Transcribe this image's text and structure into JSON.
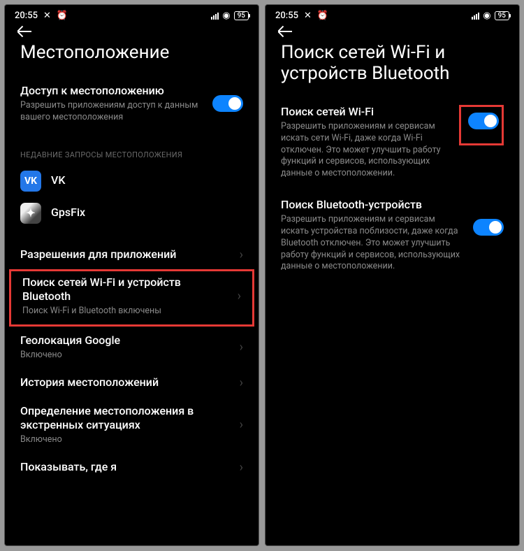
{
  "status": {
    "time": "20:55",
    "battery": "95"
  },
  "left": {
    "title": "Местоположение",
    "access": {
      "title": "Доступ к местоположению",
      "sub": "Разрешить приложениям доступ к данным вашего местоположения"
    },
    "recent_label": "НЕДАВНИЕ ЗАПРОСЫ МЕСТОПОЛОЖЕНИЯ",
    "apps": {
      "vk": "VK",
      "gpsfix": "GpsFix"
    },
    "perm": {
      "title": "Разрешения для приложений"
    },
    "scan": {
      "title": "Поиск сетей Wi-Fi и устройств Bluetooth",
      "sub": "Поиск Wi-Fi и Bluetooth включены"
    },
    "google": {
      "title": "Геолокация Google",
      "sub": "Включено"
    },
    "history": {
      "title": "История местоположений"
    },
    "emergency": {
      "title": "Определение местоположения в экстренных ситуациях",
      "sub": "Включено"
    },
    "show": {
      "title": "Показывать, где я"
    }
  },
  "right": {
    "title": "Поиск сетей Wi-Fi и устройств Bluetooth",
    "wifi": {
      "title": "Поиск сетей Wi-Fi",
      "sub": "Разрешить приложениям и сервисам искать сети Wi-Fi, даже когда Wi-Fi отключен. Это может улучшить работу функций и сервисов, использующих данные о местоположении."
    },
    "bt": {
      "title": "Поиск Bluetooth-устройств",
      "sub": "Разрешить приложениям и сервисам искать устройства поблизости, даже когда Bluetooth отключен. Это может улучшить работу функций и сервисов, использующих данные о местоположении."
    }
  }
}
